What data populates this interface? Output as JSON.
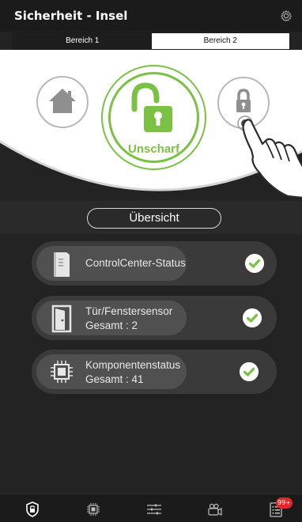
{
  "header": {
    "title": "Sicherheit - Insel",
    "settings_icon": "gear-icon"
  },
  "areas": {
    "tabs": [
      {
        "label": "Bereich 1",
        "active": true
      },
      {
        "label": "Bereich 2",
        "active": false
      }
    ]
  },
  "arming": {
    "state_label": "Unscharf",
    "state_icon": "unlocked-padlock-icon",
    "home_icon": "home-icon",
    "lock_icon": "padlock-icon",
    "pointer_icon": "pointing-hand-icon",
    "accent_color": "#7ac144"
  },
  "overview": {
    "button_label": "Übersicht"
  },
  "status_items": [
    {
      "title": "ControlCenter-Status",
      "subtitle": "",
      "icon": "control-center-icon",
      "ok": true
    },
    {
      "title": "Tür/Fenstersensor",
      "subtitle": "Gesamt : 2",
      "icon": "door-sensor-icon",
      "ok": true
    },
    {
      "title": "Komponentenstatus",
      "subtitle": "Gesamt : 41",
      "icon": "chip-icon",
      "ok": true
    }
  ],
  "bottom_nav": {
    "items": [
      {
        "name": "security",
        "icon": "shield-icon"
      },
      {
        "name": "devices",
        "icon": "chip-icon"
      },
      {
        "name": "controls",
        "icon": "sliders-icon"
      },
      {
        "name": "cameras",
        "icon": "camera-icon"
      },
      {
        "name": "log",
        "icon": "list-icon"
      }
    ],
    "badge": "99+"
  },
  "colors": {
    "background": "#232323",
    "success": "#7ac144",
    "badge": "#e1262d"
  }
}
